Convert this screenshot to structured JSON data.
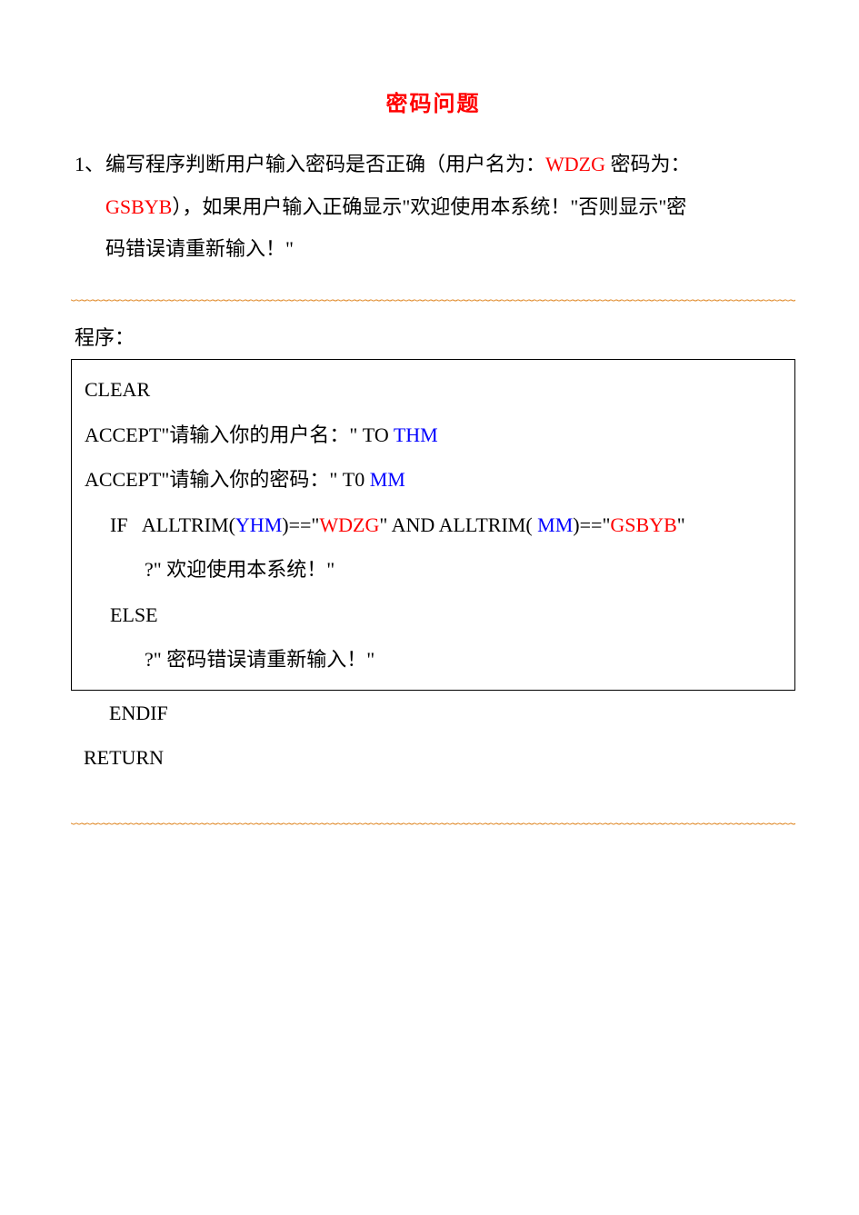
{
  "title": "密码问题",
  "problem": {
    "number": "1、",
    "t1": "编写程序判断用户输入密码是否正确（用户名为：",
    "user_label": "WDZG",
    "t2": " 密码为：",
    "pwd_label": "GSBYB",
    "t3": "），如果用户输入正确显示\"欢迎使用本系统！\"否则显示\"密",
    "t4": "码错误请重新输入！\""
  },
  "wave": "﹏﹏﹏﹏﹏﹏﹏﹏﹏﹏﹏﹏﹏﹏﹏﹏﹏﹏﹏﹏﹏﹏﹏﹏﹏﹏﹏﹏﹏﹏﹏﹏﹏﹏﹏﹏﹏﹏﹏﹏﹏﹏﹏﹏﹏﹏﹏﹏﹏﹏﹏﹏﹏﹏﹏﹏﹏﹏﹏﹏﹏﹏﹏﹏﹏﹏﹏﹏﹏﹏",
  "label_program": "程序：",
  "code": {
    "l1": "CLEAR",
    "l2a": "ACCEPT\"请输入你的用户名：\" TO ",
    "l2b": "THM",
    "l3a": "ACCEPT\"请输入你的密码：\" T0 ",
    "l3b": "MM",
    "l4a": "IF   ALLTRIM(",
    "l4b": "YHM",
    "l4c": ")==\"",
    "l4d": "WDZG",
    "l4e": "\" AND ALLTRIM( ",
    "l4f": "MM",
    "l4g": ")==\"",
    "l4h": "GSBYB",
    "l4i": "\"",
    "l5": "?\" 欢迎使用本系统！\"",
    "l6": "ELSE",
    "l7": "?\" 密码错误请重新输入！\"",
    "l8": "ENDIF",
    "l9": "RETURN"
  }
}
